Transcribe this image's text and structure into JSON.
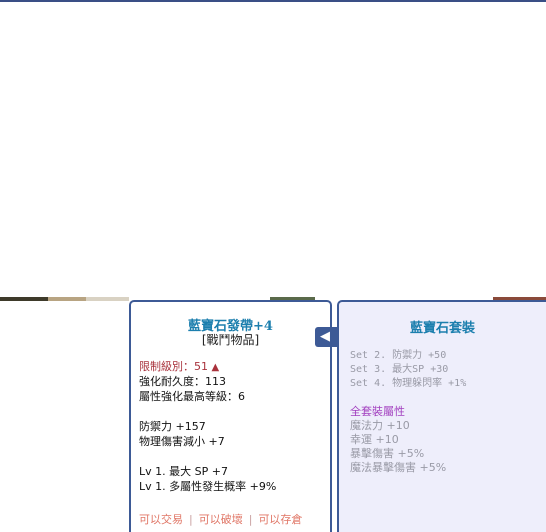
{
  "colors": {
    "frame": "#3d5a96",
    "item_name": "#1c7fae",
    "limit_level": "#a9323c",
    "footer_text": "#e07666",
    "set_bonus_text": "#999aa6",
    "full_set_label": "#a23fbf",
    "set_panel_bg": "#eeeefb"
  },
  "item": {
    "name": "藍寶石發帶+4",
    "type": "[戰鬥物品]",
    "limit_level": "限制級別：51",
    "limit_icon": "warning-triangle-icon",
    "durability": "強化耐久度：113",
    "attribute_max": "屬性強化最高等級：6",
    "defense": "防禦力 +157",
    "phys_dmg_reduce": "物理傷害減小 +7",
    "lv_line_1": "Lv 1.  最大 SP +7",
    "lv_line_2": "Lv 1.  多屬性發生概率 +9%"
  },
  "footer": {
    "tradable": "可以交易",
    "sep": "|",
    "breakable": "可以破壞",
    "storable": "可以存倉"
  },
  "connector_icon": "chevron-left-icon",
  "set": {
    "title": "藍寶石套裝",
    "bonus_1": "Set 2.  防禦力 +50",
    "bonus_2": "Set 3.  最大SP +30",
    "bonus_3": "Set 4.  物理躲閃率 +1%",
    "full_label": "全套裝屬性",
    "full_1": "魔法力 +10",
    "full_2": "幸運 +10",
    "full_3": "暴擊傷害 +5%",
    "full_4": "魔法暴擊傷害 +5%"
  }
}
